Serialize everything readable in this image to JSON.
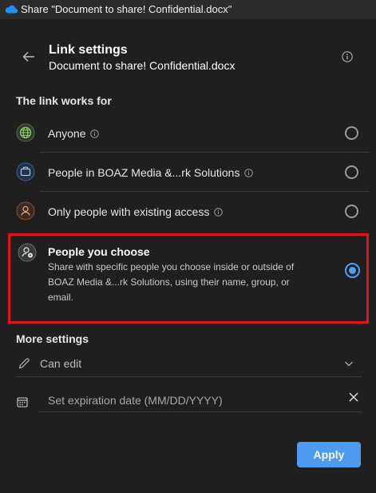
{
  "window": {
    "title": "Share \"Document to share! Confidential.docx\"",
    "app_icon": "onedrive-cloud-icon"
  },
  "header": {
    "title": "Link settings",
    "subtitle": "Document to share! Confidential.docx",
    "back_icon": "arrow-left-icon",
    "info_icon": "info-icon"
  },
  "link_works_for": {
    "heading": "The link works for",
    "options": [
      {
        "label": "Anyone",
        "icon": "globe-icon",
        "selected": false,
        "has_info": true
      },
      {
        "label": "People in BOAZ Media &...rk Solutions",
        "icon": "briefcase-icon",
        "selected": false,
        "has_info": true
      },
      {
        "label": "Only people with existing access",
        "icon": "person-icon",
        "selected": false,
        "has_info": true
      },
      {
        "label": "People you choose",
        "icon": "person-settings-icon",
        "selected": true,
        "description": "Share with specific people you choose inside or outside of BOAZ Media &...rk Solutions, using their name, group, or email."
      }
    ]
  },
  "more_settings": {
    "heading": "More settings",
    "permission": {
      "value": "Can edit",
      "icon": "pencil-icon"
    },
    "expiration": {
      "placeholder": "Set expiration date (MM/DD/YYYY)",
      "value": "",
      "icon": "calendar-icon"
    }
  },
  "actions": {
    "apply_label": "Apply"
  },
  "colors": {
    "accent": "#4c9bf0",
    "highlight_border": "#e0121a",
    "background": "#1f1f1f"
  }
}
